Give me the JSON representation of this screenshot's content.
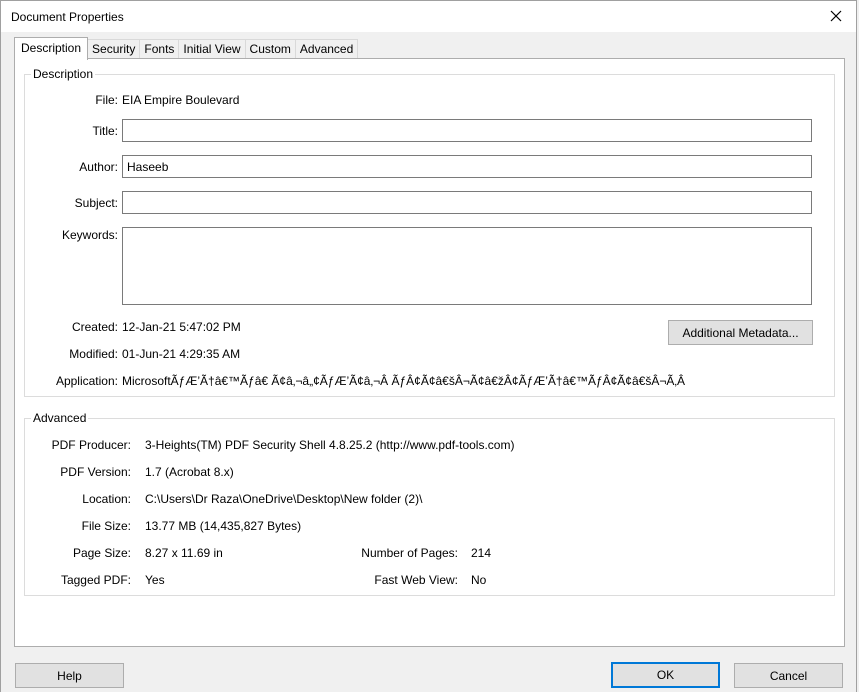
{
  "window": {
    "title": "Document Properties"
  },
  "tabs": [
    "Description",
    "Security",
    "Fonts",
    "Initial View",
    "Custom",
    "Advanced"
  ],
  "description": {
    "group_title": "Description",
    "file_label": "File:",
    "file_value": "EIA Empire Boulevard",
    "title_label": "Title:",
    "title_value": "",
    "author_label": "Author:",
    "author_value": "Haseeb",
    "subject_label": "Subject:",
    "subject_value": "",
    "keywords_label": "Keywords:",
    "keywords_value": "",
    "created_label": "Created:",
    "created_value": "12-Jan-21 5:47:02 PM",
    "modified_label": "Modified:",
    "modified_value": "01-Jun-21 4:29:35 AM",
    "application_label": "Application:",
    "application_value": "MicrosoftÃƒÆ’Ã†â€™Ãƒâ€ Ã¢â‚¬â„¢ÃƒÆ’Ã¢â‚¬Â ÃƒÂ¢Ã¢â€šÂ¬Ã¢â€žÂ¢ÃƒÆ’Ã†â€™ÃƒÂ¢Ã¢â€šÂ¬Ã‚Â",
    "metadata_button": "Additional Metadata..."
  },
  "advanced": {
    "group_title": "Advanced",
    "producer_label": "PDF Producer:",
    "producer_value": "3-Heights(TM) PDF Security Shell 4.8.25.2 (http://www.pdf-tools.com)",
    "version_label": "PDF Version:",
    "version_value": "1.7 (Acrobat 8.x)",
    "location_label": "Location:",
    "location_value": "C:\\Users\\Dr Raza\\OneDrive\\Desktop\\New folder (2)\\",
    "filesize_label": "File Size:",
    "filesize_value": "13.77 MB (14,435,827 Bytes)",
    "pagesize_label": "Page Size:",
    "pagesize_value": "8.27 x 11.69 in",
    "numpages_label": "Number of Pages:",
    "numpages_value": "214",
    "tagged_label": "Tagged PDF:",
    "tagged_value": "Yes",
    "fastweb_label": "Fast Web View:",
    "fastweb_value": "No"
  },
  "buttons": {
    "help": "Help",
    "ok": "OK",
    "cancel": "Cancel"
  },
  "icons": {
    "close": "close-icon"
  }
}
